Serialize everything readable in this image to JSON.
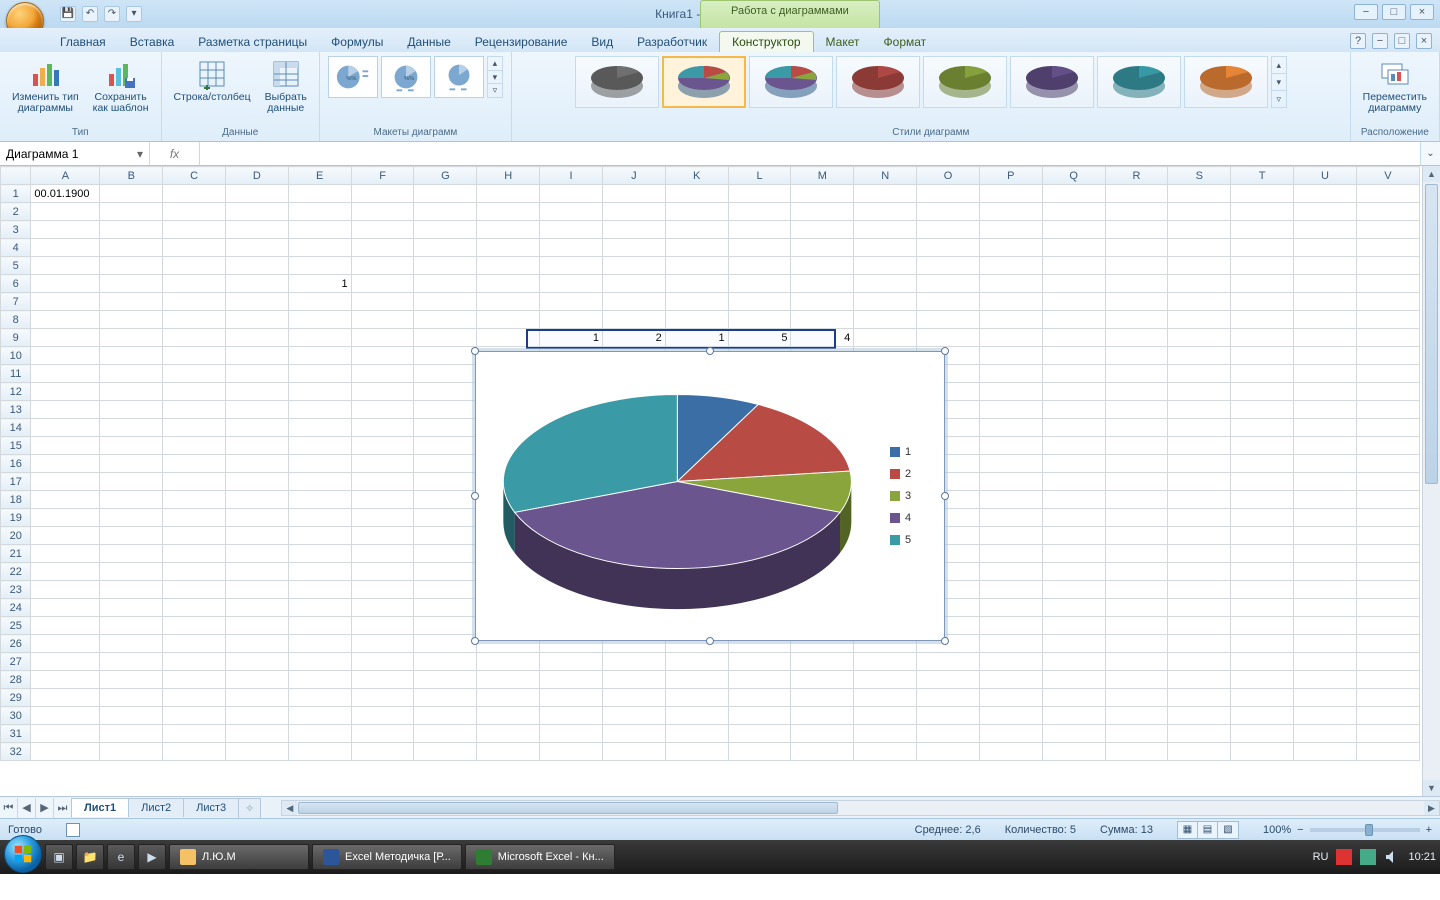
{
  "title": "Книга1 - Microsoft Excel",
  "context_title": "Работа с диаграммами",
  "ribbon_tabs": {
    "home": "Главная",
    "insert": "Вставка",
    "layout": "Разметка страницы",
    "formulas": "Формулы",
    "data": "Данные",
    "review": "Рецензирование",
    "view": "Вид",
    "developer": "Разработчик",
    "design": "Конструктор",
    "chart_layout": "Макет",
    "format": "Формат"
  },
  "ribbon": {
    "type_group": "Тип",
    "change_type": "Изменить тип\nдиаграммы",
    "save_template": "Сохранить\nкак шаблон",
    "data_group": "Данные",
    "switch_rc": "Строка/столбец",
    "select_data": "Выбрать\nданные",
    "layouts_group": "Макеты диаграмм",
    "styles_group": "Стили диаграмм",
    "location_group": "Расположение",
    "move_chart": "Переместить\nдиаграмму"
  },
  "namebox": "Диаграмма 1",
  "fx_label": "fx",
  "columns": [
    "A",
    "B",
    "C",
    "D",
    "E",
    "F",
    "G",
    "H",
    "I",
    "J",
    "K",
    "L",
    "M",
    "N",
    "O",
    "P",
    "Q",
    "R",
    "S",
    "T",
    "U",
    "V"
  ],
  "cells": {
    "A1": "00.01.1900",
    "E6": "1",
    "I9": "1",
    "J9": "2",
    "K9": "1",
    "L9": "5",
    "M9": "4"
  },
  "chart_data": {
    "type": "pie",
    "categories": [
      "1",
      "2",
      "3",
      "4",
      "5"
    ],
    "values": [
      1,
      2,
      1,
      5,
      4
    ],
    "colors": [
      "#3b6ea5",
      "#b84b43",
      "#8aa53c",
      "#6b558f",
      "#3a9aa5"
    ],
    "title": "",
    "legend_position": "right"
  },
  "sheet_tabs": {
    "s1": "Лист1",
    "s2": "Лист2",
    "s3": "Лист3"
  },
  "status": {
    "ready": "Готово",
    "avg_label": "Среднее:",
    "avg_val": "2,6",
    "count_label": "Количество:",
    "count_val": "5",
    "sum_label": "Сумма:",
    "sum_val": "13",
    "zoom": "100%"
  },
  "taskbar": {
    "folder": "Л.Ю.М",
    "word": "Excel Методичка [Р...",
    "excel": "Microsoft Excel - Кн...",
    "lang": "RU",
    "time": "10:21"
  }
}
